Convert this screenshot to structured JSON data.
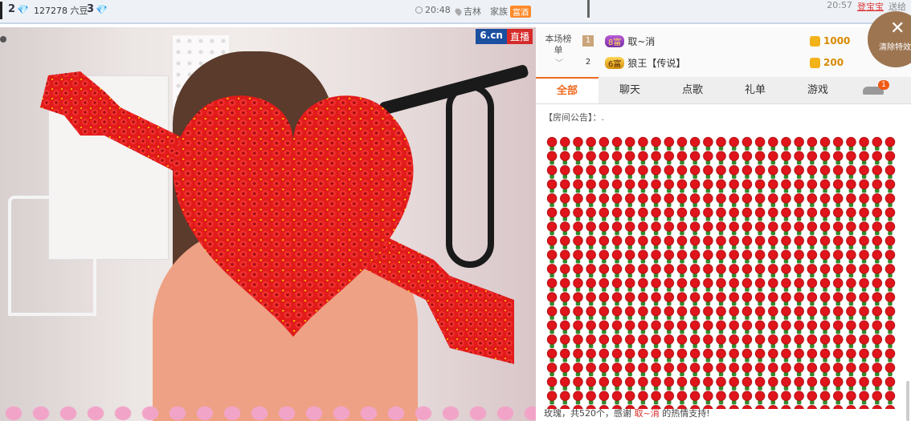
{
  "topbar": {
    "diamond_count_a": "2",
    "coins": "127278 六豆",
    "diamond_count_b": "3",
    "time": "20:48",
    "location": "吉林",
    "family_label": "家族",
    "family_badge": "富酒",
    "gift_time": "20:57",
    "gift_sender": "登宝宝",
    "gift_verb": "送给"
  },
  "video": {
    "logo_brand": "6.cn",
    "logo_live": "直播"
  },
  "rank": {
    "title": "本场榜单",
    "rows": [
      {
        "num": "1",
        "level": "8富",
        "name": "取~消",
        "amount": "1000"
      },
      {
        "num": "2",
        "level": "6富",
        "name": "狼王【传说】",
        "amount": "200"
      }
    ]
  },
  "clear_effects": {
    "icon": "✕",
    "label": "清除特效"
  },
  "tabs": [
    {
      "label": "全部"
    },
    {
      "label": "聊天"
    },
    {
      "label": "点歌"
    },
    {
      "label": "礼单"
    },
    {
      "label": "游戏"
    }
  ],
  "car_badge": "1",
  "chat": {
    "notice": "【房间公告】：.",
    "gift_line_pre": "玫瑰，共520个，感谢",
    "gift_line_name": "取~消",
    "gift_line_post": "的热情支持!"
  },
  "colors": {
    "accent_orange": "#ef6a1f",
    "rose_red": "#e0141b",
    "diamond_blue": "#2ba7e0"
  }
}
